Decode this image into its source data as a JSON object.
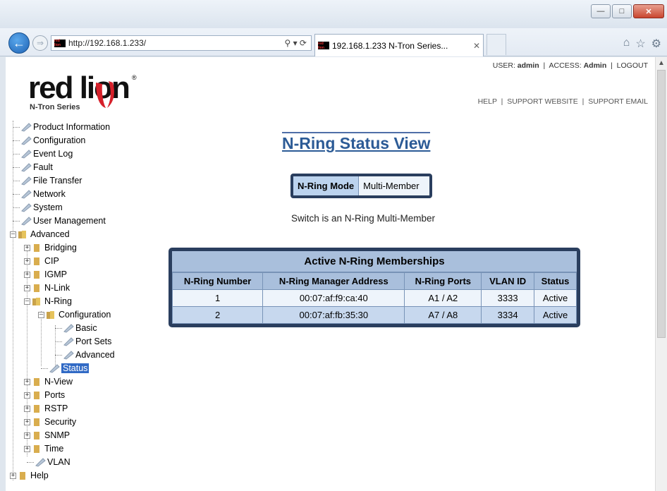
{
  "browser": {
    "url": "http://192.168.1.233/",
    "tab_title": "192.168.1.233 N-Tron Series...",
    "favicon_text": "red lion"
  },
  "header": {
    "logo_text": "red lion",
    "logo_sub": "N-Tron Series",
    "user_label": "USER:",
    "user_value": "admin",
    "access_label": "ACCESS:",
    "access_value": "Admin",
    "logout": "LOGOUT",
    "help": "HELP",
    "support_website": "SUPPORT WEBSITE",
    "support_email": "SUPPORT EMAIL"
  },
  "tree": {
    "product_information": "Product Information",
    "configuration": "Configuration",
    "event_log": "Event Log",
    "fault": "Fault",
    "file_transfer": "File Transfer",
    "network": "Network",
    "system": "System",
    "user_management": "User Management",
    "advanced": "Advanced",
    "bridging": "Bridging",
    "cip": "CIP",
    "igmp": "IGMP",
    "n_link": "N-Link",
    "n_ring": "N-Ring",
    "n_ring_configuration": "Configuration",
    "basic": "Basic",
    "port_sets": "Port Sets",
    "advanced_sub": "Advanced",
    "status": "Status",
    "n_view": "N-View",
    "ports": "Ports",
    "rstp": "RSTP",
    "security": "Security",
    "snmp": "SNMP",
    "time": "Time",
    "vlan": "VLAN",
    "help": "Help"
  },
  "main": {
    "title": "N-Ring Status View",
    "mode_label": "N-Ring Mode",
    "mode_value": "Multi-Member",
    "status_message": "Switch is an N-Ring Multi-Member",
    "memberships": {
      "caption": "Active N-Ring Memberships",
      "headers": [
        "N-Ring Number",
        "N-Ring Manager Address",
        "N-Ring Ports",
        "VLAN ID",
        "Status"
      ],
      "rows": [
        [
          "1",
          "00:07:af:f9:ca:40",
          "A1 / A2",
          "3333",
          "Active"
        ],
        [
          "2",
          "00:07:af:fb:35:30",
          "A7 / A8",
          "3334",
          "Active"
        ]
      ]
    }
  }
}
